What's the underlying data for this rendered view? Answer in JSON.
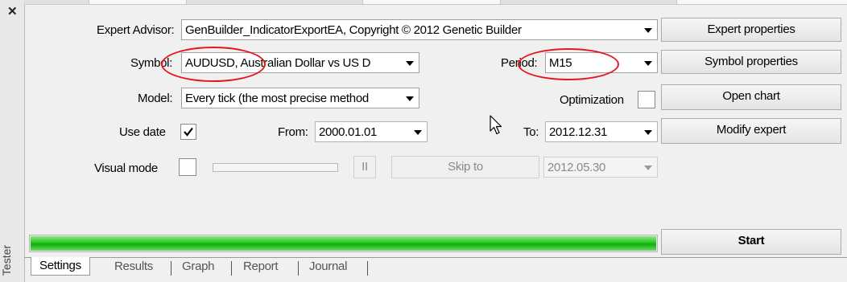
{
  "panel": {
    "close_icon": "close-icon",
    "side_title": "Tester"
  },
  "expert": {
    "label": "Expert Advisor:",
    "value": "GenBuilder_IndicatorExportEA, Copyright © 2012 Genetic Builder"
  },
  "symbol": {
    "label": "Symbol:",
    "value": "AUDUSD, Australian Dollar vs US D"
  },
  "period": {
    "label": "Period:",
    "value": "M15"
  },
  "model": {
    "label": "Model:",
    "value": "Every tick (the most precise method"
  },
  "optimization": {
    "label": "Optimization",
    "checked": false
  },
  "use_date": {
    "label": "Use date",
    "checked": true
  },
  "from": {
    "label": "From:",
    "value": "2000.01.01"
  },
  "to": {
    "label": "To:",
    "value": "2012.12.31"
  },
  "visual_mode": {
    "label": "Visual mode",
    "checked": false,
    "speed_level": 0,
    "pause_label": "II",
    "skip_to_label": "Skip to",
    "skip_date": "2012.05.30"
  },
  "buttons": {
    "expert_properties": "Expert properties",
    "symbol_properties": "Symbol properties",
    "open_chart": "Open chart",
    "modify_expert": "Modify expert",
    "start": "Start"
  },
  "progress": {
    "percent": 100,
    "color": "#1fbf19"
  },
  "highlight_color": "#e8141e",
  "tabs": [
    {
      "label": "Settings",
      "active": true
    },
    {
      "label": "Results",
      "active": false
    },
    {
      "label": "Graph",
      "active": false
    },
    {
      "label": "Report",
      "active": false
    },
    {
      "label": "Journal",
      "active": false
    }
  ]
}
